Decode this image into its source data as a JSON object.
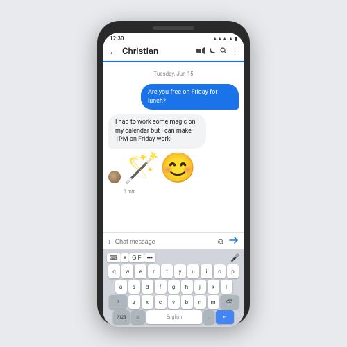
{
  "statusBar": {
    "time": "12:30",
    "batteryIcon": "▮",
    "wifiIcon": "▲",
    "signalIcon": "▲"
  },
  "header": {
    "backIcon": "←",
    "title": "Christian",
    "videoIcon": "▷",
    "callIcon": "✆",
    "searchIcon": "🔍",
    "moreIcon": "⋮"
  },
  "chat": {
    "dateDivider": "Tuesday, Jun 15",
    "sentMessage": "Are you free on Friday for lunch?",
    "receivedMessage": "I had to work some magic on my calendar but I can make 1PM on Friday work!",
    "sticker": "🪄",
    "timestamp": "1 min"
  },
  "inputArea": {
    "chevron": "›",
    "placeholder": "Chat message",
    "emojiIcon": "☺",
    "sendIcon": "▶"
  },
  "keyboard": {
    "toolbar": {
      "btn1": "⌨",
      "btn2": "≡",
      "btn3": "GIF",
      "btn4": "•••",
      "micIcon": "🎤"
    },
    "rows": [
      [
        "q",
        "w",
        "e",
        "r",
        "t",
        "y",
        "u",
        "i",
        "o",
        "p"
      ],
      [
        "a",
        "s",
        "d",
        "f",
        "g",
        "h",
        "j",
        "k",
        "l"
      ],
      [
        "z",
        "x",
        "c",
        "v",
        "b",
        "n",
        "m"
      ],
      [
        "?123",
        "☺",
        "space",
        ".",
        "↵"
      ]
    ]
  }
}
